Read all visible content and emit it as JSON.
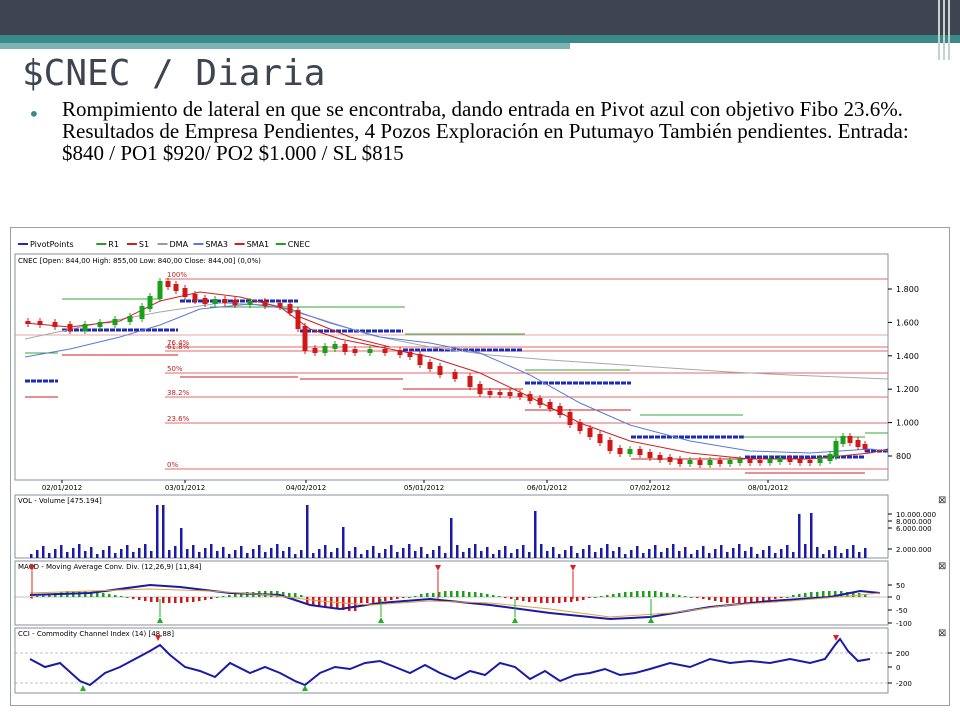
{
  "slide": {
    "title": "$CNEC / Diaria",
    "bullet": "Rompimiento de lateral en que se encontraba, dando entrada en Pivot azul con objetivo Fibo 23.6%. Resultados de Empresa Pendientes, 4 Pozos Exploración en Putumayo También pendientes. Entrada: $840 / PO1 $920/ PO2 $1.000 / SL $815",
    "colors": {
      "topbar": "#3f4451",
      "accent": "#3a8a8a",
      "accent_light": "#7fb3b3"
    }
  },
  "chart_data": [
    {
      "type": "candlestick",
      "legend": [
        {
          "name": "PivotPoints",
          "color": "#1c2ab5"
        },
        {
          "name": "R1",
          "color": "#2a9a2a"
        },
        {
          "name": "S1",
          "color": "#d02020"
        },
        {
          "name": "DMA",
          "color": "#9a9a9a"
        },
        {
          "name": "SMA3",
          "color": "#5a7ad8"
        },
        {
          "name": "SMA1",
          "color": "#d02020"
        },
        {
          "name": "CNEC",
          "color": "#2a9a2a"
        }
      ],
      "info": "CNEC [Open: 844,00  High: 855,00  Low: 840,00  Close: 844,00] (0,0%)",
      "y_ticks": [
        "1.800",
        "1.600",
        "1.400",
        "1.200",
        "1.000",
        "800"
      ],
      "x_ticks": [
        "02/01/2012",
        "03/01/2012",
        "04/02/2012",
        "05/01/2012",
        "06/01/2012",
        "07/02/2012",
        "08/01/2012"
      ],
      "fib_labels": [
        "100%",
        "76.4%",
        "61.8%",
        "50%",
        "38.2%",
        "23.6%",
        "0%"
      ]
    },
    {
      "type": "bar",
      "label": "VOL - Volume [475.194]",
      "y_ticks": [
        "10.000.000",
        "8.000.000",
        "6.000.000",
        "2.000.000"
      ]
    },
    {
      "type": "line",
      "label": "MACD - Moving Average Conv. Div. (12,26,9) [11,84]",
      "y_ticks": [
        "50",
        "0",
        "-50",
        "-100"
      ]
    },
    {
      "type": "line",
      "label": "CCI - Commodity Channel Index (14) [48,88]",
      "y_ticks": [
        "200",
        "0",
        "-200"
      ]
    }
  ]
}
